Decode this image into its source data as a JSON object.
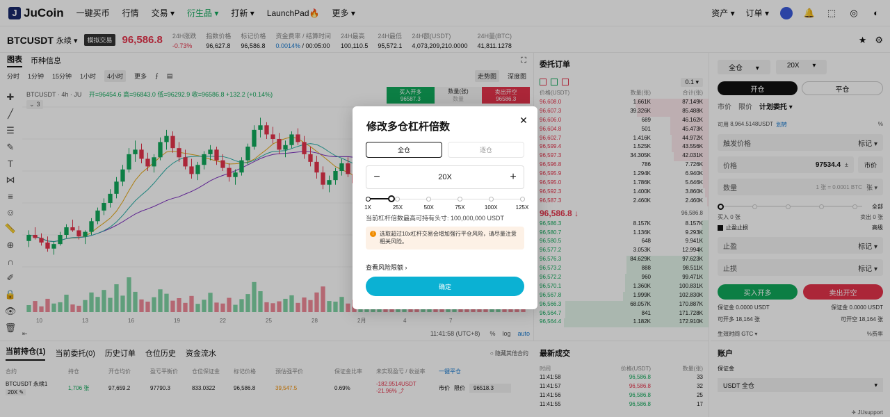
{
  "nav": {
    "logo": "JuCoin",
    "items": [
      "一键买币",
      "行情",
      "交易",
      "衍生品",
      "打新",
      "LaunchPad",
      "更多"
    ],
    "launchpad_emoji": "🔥",
    "right": [
      "资产",
      "订单"
    ]
  },
  "ticker": {
    "symbol": "BTCUSDT",
    "suffix": "永续",
    "badge": "模拟交易",
    "price": "96,586.8",
    "stats": [
      {
        "k": "24H涨跌",
        "v": "-0.73%",
        "tone": "red"
      },
      {
        "k": "指数价格",
        "v": "96,627.8",
        "tone": ""
      },
      {
        "k": "标记价格",
        "v": "96,586.8",
        "tone": ""
      },
      {
        "k": "资金费率 / 结算时间",
        "v": "0.0014%",
        "v2": " / 00:05:00",
        "tone": "blue"
      },
      {
        "k": "24H最高",
        "v": "100,110.5",
        "tone": ""
      },
      {
        "k": "24H最低",
        "v": "95,572.1",
        "tone": ""
      },
      {
        "k": "24H额(USDT)",
        "v": "4,073,209,210.0000",
        "tone": ""
      },
      {
        "k": "24H量(BTC)",
        "v": "41,811.1278",
        "tone": ""
      }
    ]
  },
  "chart": {
    "tabs": [
      "图表",
      "币种信息"
    ],
    "intervals": [
      "分时",
      "1分钟",
      "15分钟",
      "1小时",
      "4小时",
      "更多"
    ],
    "active_interval": "4小时",
    "views": [
      "走势图",
      "深度图"
    ],
    "info_symbol": "BTCUSDT · 4h · JU",
    "ohlc": "开=96454.6  高=96843.0  低=96292.9  收=96586.8  +132.2 (+0.14%)",
    "indicator_count": "3",
    "buy_label": "买入开多",
    "buy_price": "96587.3",
    "qty_label": "数量(张)",
    "qty_value": "数量",
    "sell_label": "卖出开空",
    "sell_price": "96586.3",
    "x_labels": [
      "10",
      "13",
      "16",
      "19",
      "22",
      "25",
      "28",
      "2月",
      "4",
      "7"
    ],
    "time_display": "11:41:58 (UTC+8)",
    "scale_opts": [
      "%",
      "log",
      "auto"
    ],
    "chart_data": {
      "type": "candlestick",
      "candles": [
        [
          94200,
          94900,
          93800,
          94600
        ],
        [
          94600,
          95100,
          94300,
          94400
        ],
        [
          94400,
          94700,
          93900,
          94100
        ],
        [
          94100,
          94500,
          93500,
          93700
        ],
        [
          93700,
          94200,
          93300,
          94000
        ],
        [
          94000,
          94800,
          93900,
          94600
        ],
        [
          94600,
          95300,
          94400,
          95100
        ],
        [
          95100,
          95600,
          94800,
          94900
        ],
        [
          94900,
          95200,
          94300,
          94500
        ],
        [
          94500,
          94900,
          94000,
          94800
        ],
        [
          94800,
          95700,
          94600,
          95500
        ],
        [
          95500,
          96400,
          95300,
          96200
        ],
        [
          96200,
          97000,
          95900,
          96700
        ],
        [
          96700,
          97600,
          96400,
          97300
        ],
        [
          97300,
          98400,
          97000,
          98100
        ],
        [
          98100,
          99200,
          97800,
          98900
        ],
        [
          98900,
          100300,
          98700,
          99900
        ],
        [
          99900,
          100800,
          99400,
          100200
        ],
        [
          100200,
          100600,
          99300,
          99600
        ],
        [
          99600,
          100000,
          98800,
          99100
        ],
        [
          99100,
          99900,
          98700,
          99700
        ],
        [
          99700,
          101000,
          99500,
          100700
        ],
        [
          100700,
          101500,
          100200,
          101100
        ],
        [
          101100,
          101400,
          100000,
          100300
        ],
        [
          100300,
          100700,
          99400,
          99700
        ],
        [
          99700,
          100200,
          98900,
          99100
        ],
        [
          99100,
          99600,
          98300,
          98600
        ],
        [
          98600,
          99400,
          98200,
          99200
        ],
        [
          99200,
          100100,
          98900,
          99900
        ],
        [
          99900,
          100500,
          99500,
          100200
        ],
        [
          100200,
          100400,
          99200,
          99500
        ],
        [
          99500,
          99900,
          98800,
          99000
        ],
        [
          99000,
          99300,
          98100,
          98400
        ],
        [
          98400,
          98900,
          97900,
          98700
        ],
        [
          98700,
          99700,
          98500,
          99500
        ],
        [
          99500,
          100600,
          99200,
          100400
        ],
        [
          100400,
          101800,
          100200,
          101500
        ],
        [
          101500,
          102300,
          101000,
          101800
        ],
        [
          101800,
          102000,
          100900,
          101200
        ],
        [
          101200,
          101700,
          100600,
          100900
        ],
        [
          100900,
          101300,
          99900,
          100200
        ],
        [
          100200,
          100800,
          99700,
          100500
        ],
        [
          100500,
          101400,
          100300,
          101200
        ],
        [
          101200,
          101600,
          100500,
          100700
        ],
        [
          100700,
          101100,
          99600,
          99900
        ],
        [
          99900,
          100400,
          99100,
          99400
        ],
        [
          99400,
          99800,
          98300,
          98700
        ],
        [
          98700,
          99100,
          97600,
          97900
        ],
        [
          97900,
          98500,
          97400,
          98200
        ],
        [
          98200,
          99000,
          97900,
          98800
        ],
        [
          98800,
          99600,
          98500,
          99300
        ],
        [
          99300,
          99700,
          98400,
          98600
        ],
        [
          98600,
          98900,
          97700,
          98000
        ],
        [
          98000,
          98600,
          97500,
          98400
        ],
        [
          98400,
          99300,
          98200,
          99100
        ],
        [
          99100,
          99800,
          98700,
          99500
        ],
        [
          99500,
          100200,
          99200,
          100000
        ],
        [
          100000,
          100400,
          99300,
          99600
        ],
        [
          99600,
          99900,
          98600,
          98900
        ],
        [
          98900,
          99400,
          98500,
          99200
        ],
        [
          99200,
          99800,
          98900,
          99600
        ],
        [
          99600,
          99900,
          98800,
          99100
        ],
        [
          99100,
          99500,
          98600,
          98900
        ],
        [
          98900,
          99700,
          98700,
          99500
        ],
        [
          99500,
          100100,
          99200,
          99800
        ],
        [
          99800,
          100000,
          98900,
          99200
        ],
        [
          99200,
          99500,
          98300,
          98600
        ],
        [
          98600,
          99200,
          98300,
          99000
        ],
        [
          99000,
          99600,
          98700,
          99400
        ],
        [
          99400,
          99700,
          98500,
          98800
        ],
        [
          98800,
          99100,
          97800,
          98100
        ],
        [
          98100,
          98600,
          97500,
          97800
        ],
        [
          97800,
          98300,
          96900,
          97200
        ],
        [
          97200,
          97700,
          96300,
          96600
        ],
        [
          96600,
          97400,
          96200,
          97100
        ],
        [
          97100,
          97900,
          96800,
          97600
        ],
        [
          97600,
          98100,
          96900,
          97300
        ],
        [
          97300,
          97800,
          96700,
          97000
        ],
        [
          97000,
          97500,
          96200,
          96500
        ],
        [
          96500,
          96900,
          95800,
          96300
        ]
      ],
      "volumes": [
        22,
        35,
        18,
        42,
        27,
        31,
        55,
        24,
        20,
        38,
        62,
        48,
        70,
        45,
        88,
        52,
        110,
        64,
        40,
        33,
        47,
        72,
        58,
        36,
        44,
        29,
        51,
        26,
        39,
        61,
        30,
        27,
        45,
        23,
        41,
        57,
        95,
        66,
        31,
        28,
        34,
        42,
        53,
        29,
        46,
        38,
        62,
        81,
        35,
        33,
        48,
        27,
        39,
        24,
        44,
        52,
        37,
        29,
        58,
        23,
        31,
        26,
        35,
        40,
        28,
        33,
        47,
        22,
        31,
        36,
        55,
        38,
        64,
        57,
        33,
        40,
        29,
        26,
        44,
        35
      ],
      "ylim": [
        92500,
        103000
      ]
    }
  },
  "orderbook": {
    "title": "委托订单",
    "precision": "0.1",
    "headers": [
      "价格(USDT)",
      "数量(张)",
      "合计(张)"
    ],
    "asks": [
      [
        "96,608.0",
        "1.661K",
        "87.149K",
        0.42
      ],
      [
        "96,607.3",
        "39.326K",
        "85.488K",
        0.41
      ],
      [
        "96,606.0",
        "689",
        "46.162K",
        0.22
      ],
      [
        "96,604.8",
        "501",
        "45.473K",
        0.22
      ],
      [
        "96,602.7",
        "1.416K",
        "44.972K",
        0.21
      ],
      [
        "96,599.4",
        "1.525K",
        "43.556K",
        0.21
      ],
      [
        "96,597.3",
        "34.305K",
        "42.031K",
        0.2
      ],
      [
        "96,596.8",
        "786",
        "7.726K",
        0.04
      ],
      [
        "96,595.9",
        "1.294K",
        "6.940K",
        0.03
      ],
      [
        "96,595.0",
        "1.786K",
        "5.646K",
        0.03
      ],
      [
        "96,592.3",
        "1.400K",
        "3.860K",
        0.02
      ],
      [
        "96,587.3",
        "2.460K",
        "2.460K",
        0.01
      ]
    ],
    "mid_price": "96,586.8",
    "mid_ref": "96,586.8",
    "bids": [
      [
        "96,586.3",
        "8.157K",
        "8.157K",
        0.04
      ],
      [
        "96,580.7",
        "1.136K",
        "9.293K",
        0.05
      ],
      [
        "96,580.5",
        "648",
        "9.941K",
        0.05
      ],
      [
        "96,577.2",
        "3.053K",
        "12.994K",
        0.06
      ],
      [
        "96,576.3",
        "84.629K",
        "97.623K",
        0.47
      ],
      [
        "96,573.2",
        "888",
        "98.511K",
        0.47
      ],
      [
        "96,572.2",
        "960",
        "99.471K",
        0.48
      ],
      [
        "96,570.1",
        "1.360K",
        "100.831K",
        0.48
      ],
      [
        "96,567.8",
        "1.999K",
        "102.830K",
        0.49
      ],
      [
        "96,566.3",
        "68.057K",
        "170.887K",
        0.82
      ],
      [
        "96,564.7",
        "841",
        "171.728K",
        0.82
      ],
      [
        "96,564.4",
        "1.182K",
        "172.910K",
        0.83
      ]
    ]
  },
  "trade": {
    "margin_mode": "全仓",
    "leverage": "20X",
    "open": "开仓",
    "close": "平仓",
    "types": [
      "市价",
      "限价",
      "计划委托"
    ],
    "available_label": "可用",
    "available": "8,964.5148USDT",
    "transfer": "划转",
    "pct_icon": "%",
    "trigger_label": "触发价格",
    "trigger_type": "标记",
    "price_label": "价格",
    "price_value": "97534.4",
    "market_btn": "市价",
    "qty_label": "数量",
    "qty_placeholder": "1 张 = 0.0001 BTC",
    "qty_unit": "张",
    "all": "全部",
    "buy_qty": "买入 0 张",
    "sell_qty": "卖出 0 张",
    "tpsl": "止盈止损",
    "advanced": "高级",
    "tp": "止盈",
    "sl": "止损",
    "long_btn": "买入开多",
    "short_btn": "卖出开空",
    "margin_l": "保证金 0.0000 USDT",
    "margin_r": "保证金 0.0000 USDT",
    "openable_l": "可开多 18,164 张",
    "openable_r": "可开空 18,164 张",
    "tif": "生效时间 GTC",
    "fee": "费率"
  },
  "positions": {
    "tabs": [
      "当前持仓(1)",
      "当前委托(0)",
      "历史订单",
      "仓位历史",
      "资金流水"
    ],
    "hide_others": "隐藏其他合约",
    "headers": [
      "合约",
      "持仓",
      "开仓均价",
      "盈亏平衡价",
      "仓位保证金",
      "标记价格",
      "预估强平价",
      "保证金比率",
      "未实现盈亏 / 收益率",
      "一键平仓"
    ],
    "row": {
      "contract": "BTCUSDT 永续1",
      "leverage": "20X",
      "size": "1,706 张",
      "entry": "97,659.2",
      "breakeven": "97790.3",
      "margin": "833.0322",
      "mark": "96,586.8",
      "liq": "39,547.5",
      "ratio": "0.69%",
      "pnl": "-182.9514USDT",
      "roe": "-21.96%",
      "close_market": "市价",
      "close_limit": "限价",
      "close_price": "96518.3"
    }
  },
  "trades": {
    "title": "最新成交",
    "headers": [
      "时间",
      "价格(USDT)",
      "数量(张)"
    ],
    "rows": [
      [
        "11:41:58",
        "96,586.8",
        "33",
        "green"
      ],
      [
        "11:41:57",
        "96,586.8",
        "32",
        "red"
      ],
      [
        "11:41:56",
        "96,586.8",
        "25",
        "green"
      ],
      [
        "11:41:55",
        "96,586.8",
        "17",
        "green"
      ]
    ]
  },
  "account": {
    "title": "账户",
    "margin_label": "保证金",
    "select": "USDT 全仓",
    "support": "JUsupport"
  },
  "modal": {
    "title": "修改多仓杠杆倍数",
    "mode_on": "全仓",
    "mode_off": "逐仓",
    "value": "20X",
    "ticks": [
      "1X",
      "25X",
      "50X",
      "75X",
      "100X",
      "125X"
    ],
    "level": 20,
    "max_position": "当前杠杆倍数最高可持有头寸:  100,000,000 USDT",
    "warning": "选取超过10x杠杆交易会增加强行平仓风险，请尽量注意相关风险。",
    "risk_link": "查看风险限额",
    "confirm": "确定"
  }
}
